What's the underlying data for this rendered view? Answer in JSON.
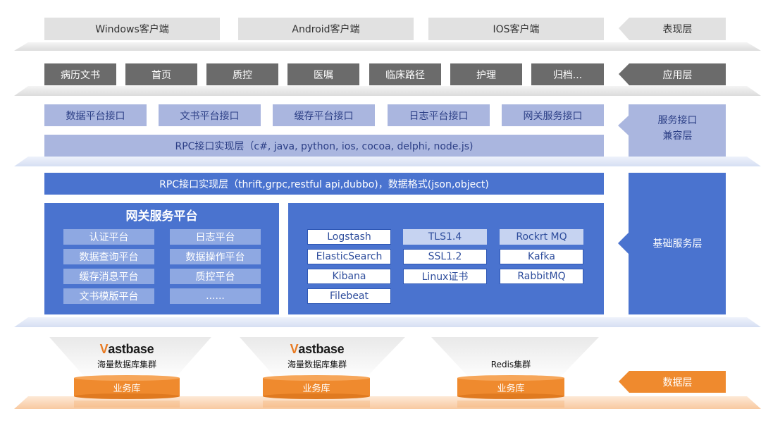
{
  "presentation": {
    "clients": [
      "Windows客户端",
      "Android客户端",
      "IOS客户端"
    ],
    "side_label": "表现层"
  },
  "application": {
    "modules": [
      "病历文书",
      "首页",
      "质控",
      "医嘱",
      "临床路径",
      "护理",
      "归档..."
    ],
    "side_label": "应用层"
  },
  "service_interface": {
    "interfaces": [
      "数据平台接口",
      "文书平台接口",
      "缓存平台接口",
      "日志平台接口",
      "网关服务接口"
    ],
    "rpc_label": "RPC接口实现层（c#, java, python, ios, cocoa, delphi, node.js)",
    "side_label_line1": "服务接口",
    "side_label_line2": "兼容层"
  },
  "base_service": {
    "rpc_label": "RPC接口实现层（thrift,grpc,restful api,dubbo)，数据格式(json,object)",
    "gateway_title": "网关服务平台",
    "gateway_items": [
      "认证平台",
      "日志平台",
      "数据查询平台",
      "数据操作平台",
      "缓存消息平台",
      "质控平台",
      "文书模版平台",
      "......"
    ],
    "col1": [
      "Logstash",
      "ElasticSearch",
      "Kibana",
      "Filebeat"
    ],
    "col2": [
      "TLS1.4",
      "SSL1.2",
      "Linux证书"
    ],
    "col3": [
      "Rockrt MQ",
      "Kafka",
      "RabbitMQ"
    ],
    "side_label": "基础服务层"
  },
  "data_layer": {
    "clusters": [
      {
        "brand_accent": "V",
        "brand_rest": "astbase",
        "caption": "海量数据库集群",
        "disk_label": "业务库"
      },
      {
        "brand_accent": "V",
        "brand_rest": "astbase",
        "caption": "海量数据库集群",
        "disk_label": "业务库"
      },
      {
        "brand_accent": "",
        "brand_rest": "",
        "caption": "Redis集群",
        "disk_label": "业务库"
      }
    ],
    "side_label": "数据层"
  },
  "colors": {
    "accent_blue": "#4a73cf",
    "light_blue": "#aab6df",
    "orange": "#ef8a2e",
    "dark_gray": "#6b6b6b",
    "light_gray": "#e1e1e1"
  }
}
